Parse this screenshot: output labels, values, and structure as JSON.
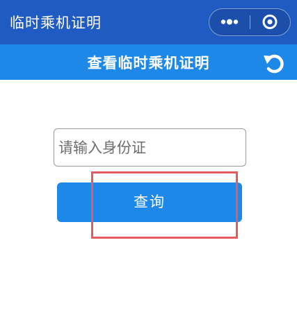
{
  "nav": {
    "title": "临时乘机证明",
    "more_icon": "more-dots-icon",
    "close_icon": "target-close-icon"
  },
  "header": {
    "title": "查看临时乘机证明",
    "refresh_icon": "refresh-icon"
  },
  "form": {
    "id_placeholder": "请输入身份证",
    "id_value": "",
    "query_label": "查询"
  },
  "colors": {
    "nav_bg": "#1f5bc3",
    "header_bg": "#1e88e8",
    "button_bg": "#1e88e8",
    "highlight": "#e35b5f"
  }
}
